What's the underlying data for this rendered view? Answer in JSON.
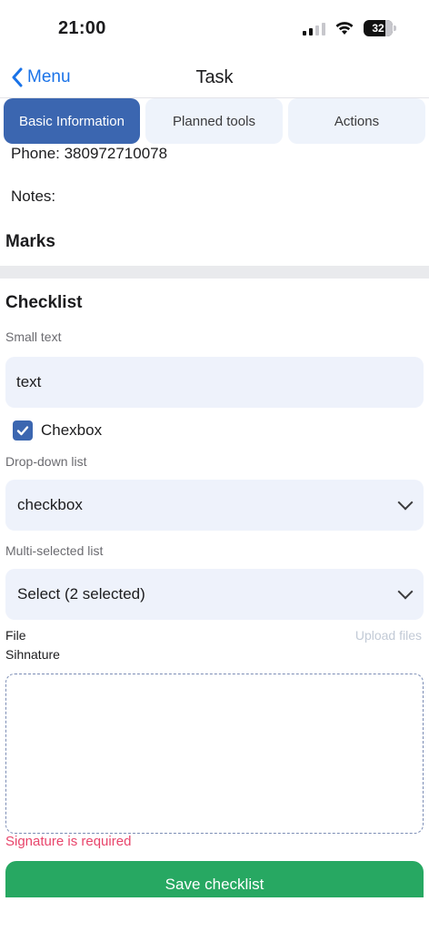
{
  "status_bar": {
    "time": "21:00",
    "battery": "32",
    "icons": [
      "cellular-signal-icon",
      "wifi-icon",
      "battery-icon"
    ]
  },
  "nav": {
    "back_label": "Menu",
    "title": "Task"
  },
  "tabs": [
    {
      "label": "Basic Information",
      "active": true
    },
    {
      "label": "Planned tools",
      "active": false
    },
    {
      "label": "Actions",
      "active": false
    }
  ],
  "basic_info": {
    "phone": "Phone: 380972710078",
    "notes": "Notes:",
    "marks_title": "Marks"
  },
  "checklist": {
    "title": "Checklist",
    "small_text": {
      "label": "Small text",
      "value": "text"
    },
    "checkbox": {
      "label": "Chexbox",
      "checked": true
    },
    "dropdown": {
      "label": "Drop-down list",
      "value": "checkbox"
    },
    "multi_select": {
      "label": "Multi-selected list",
      "value": "Select (2 selected)"
    },
    "file": {
      "label": "File",
      "upload_label": "Upload files"
    },
    "signature": {
      "label": "Sihnature",
      "error": "Signature is required"
    },
    "save_label": "Save checklist"
  },
  "colors": {
    "accent": "#3b66b0",
    "link": "#1a73e8",
    "success": "#27a862",
    "error": "#e8456b",
    "field_bg": "#eef2fb"
  }
}
